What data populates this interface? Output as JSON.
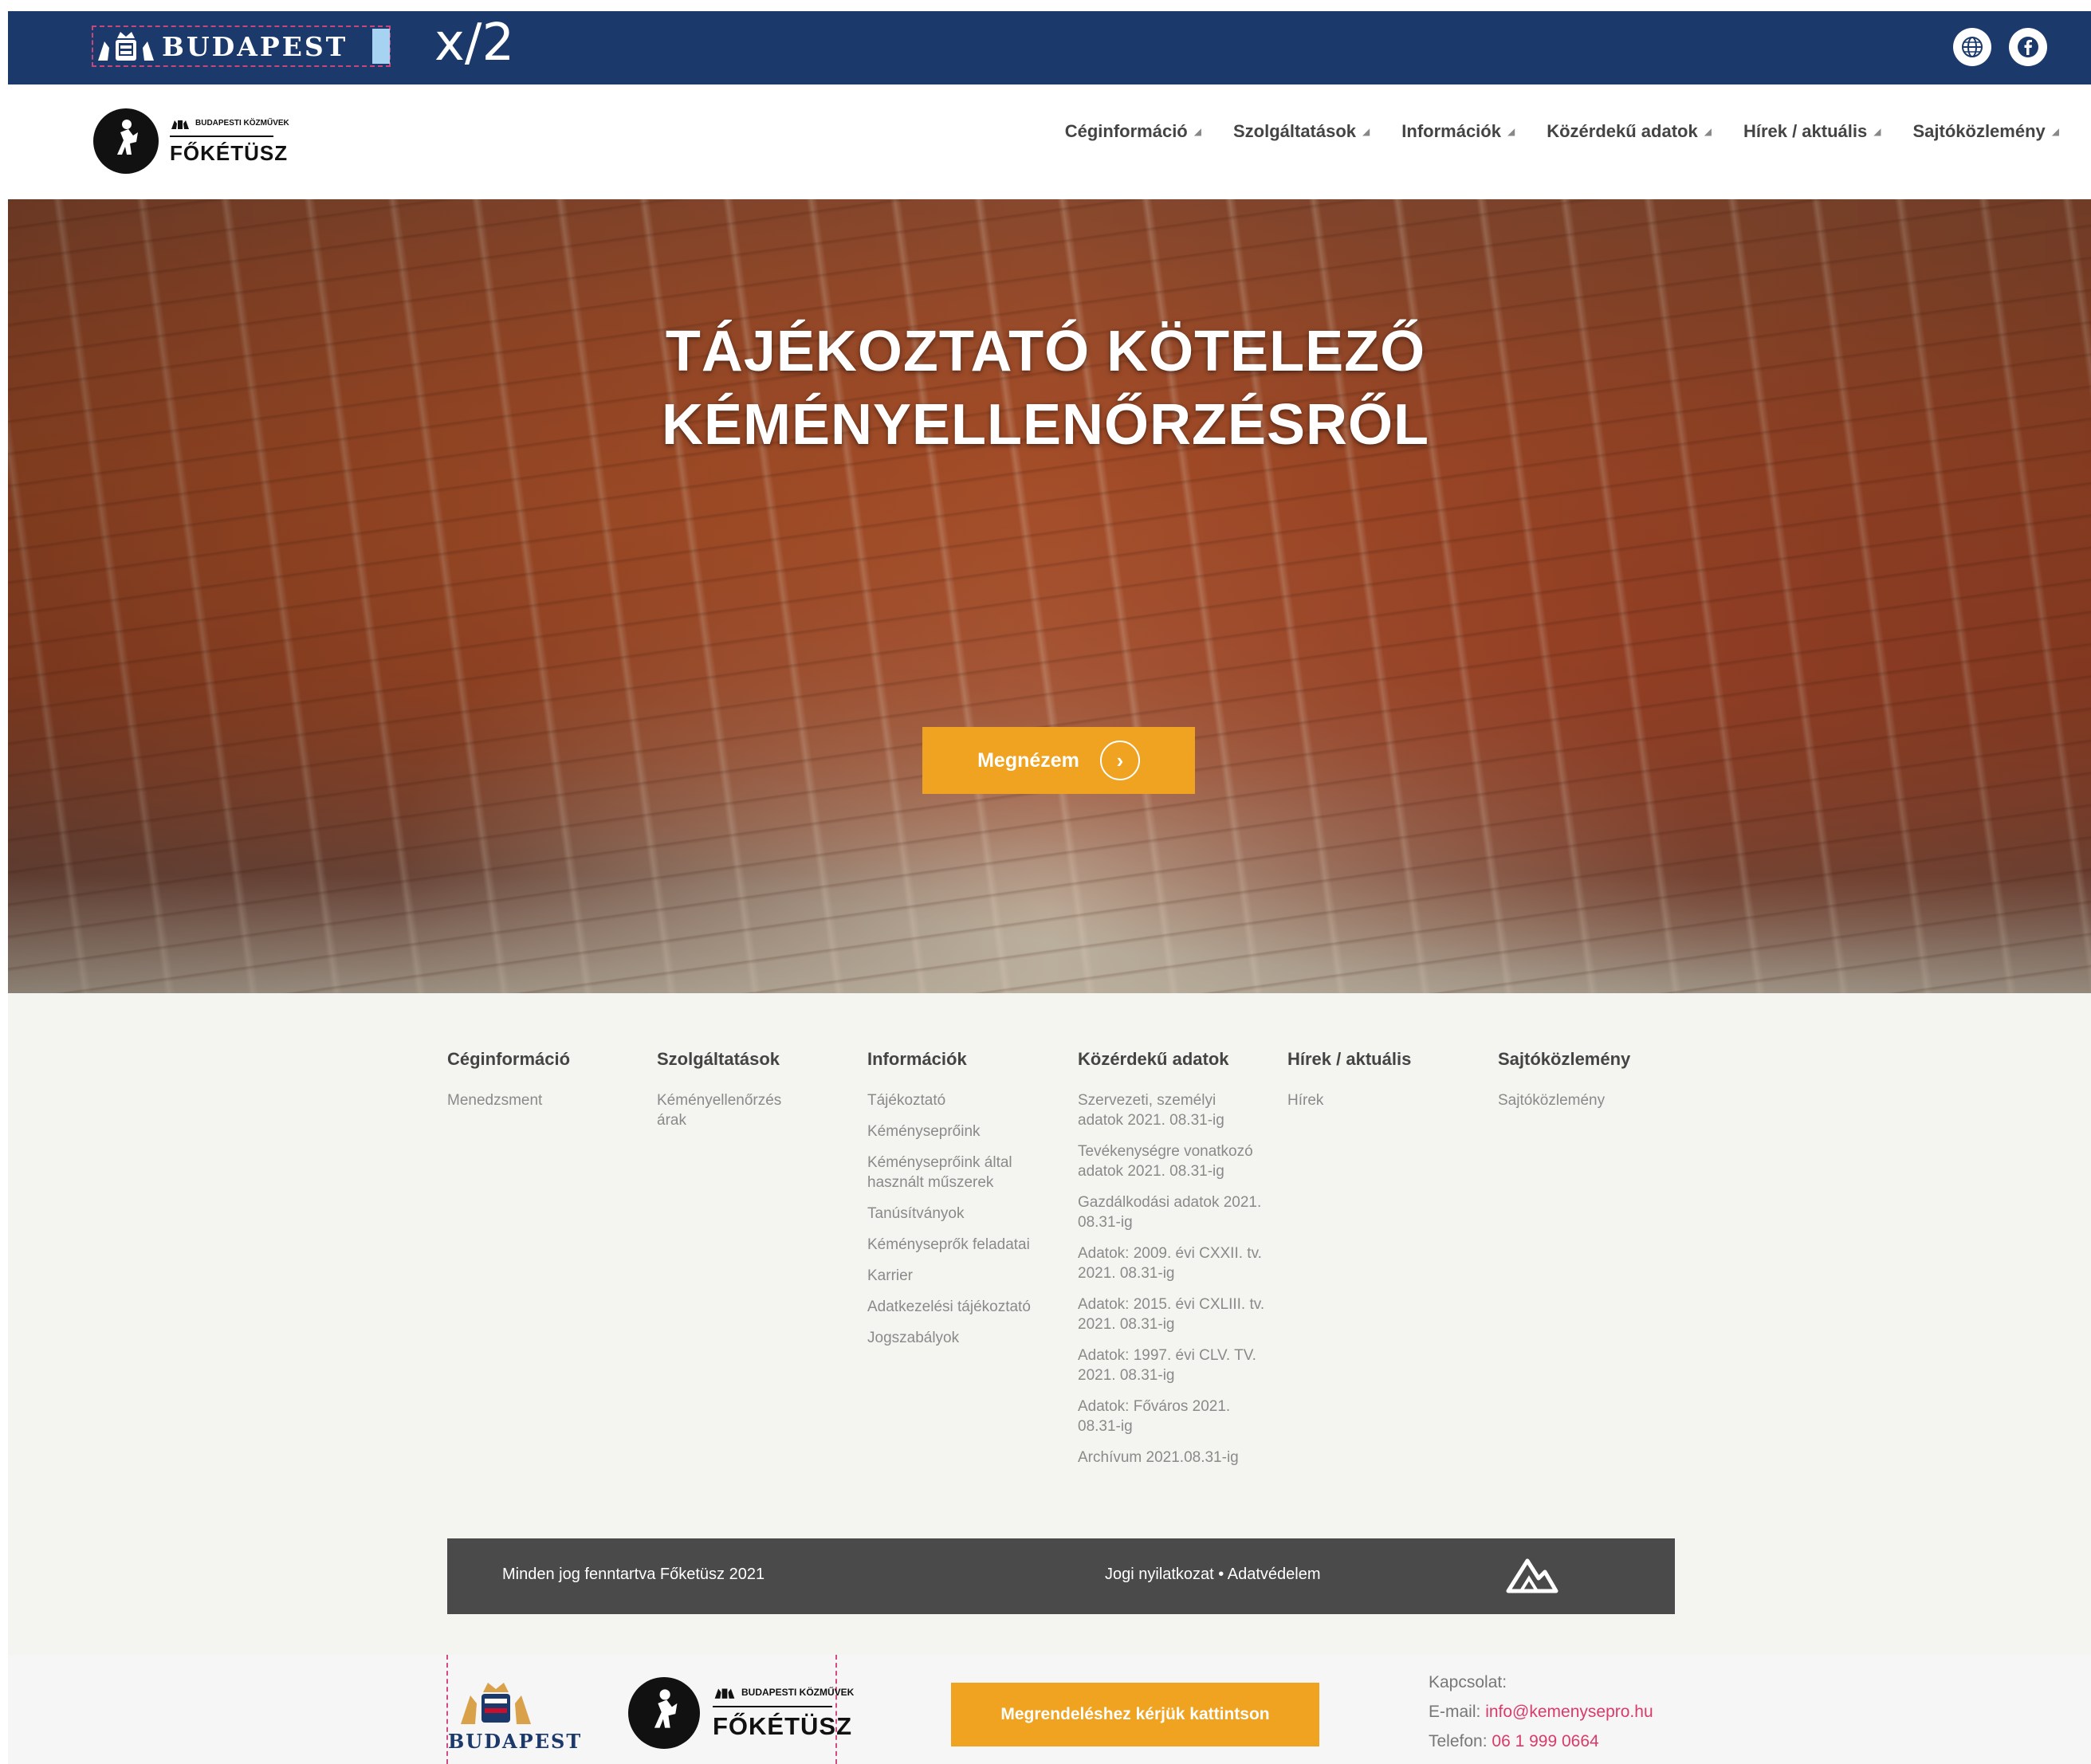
{
  "topbar": {
    "city_name": "BUDAPEST",
    "xmark": "x/2",
    "globe_icon": "globe-icon",
    "facebook_icon": "facebook-icon",
    "background_color": "#1b3a6b"
  },
  "header": {
    "brand_small_text": "BUDAPESTI KÖZMŰVEK",
    "brand_name": "FŐKÉTÜSZ",
    "nav": [
      {
        "label": "Céginformáció"
      },
      {
        "label": "Szolgáltatások"
      },
      {
        "label": "Információk"
      },
      {
        "label": "Közérdekű adatok"
      },
      {
        "label": "Hírek / aktuális"
      },
      {
        "label": "Sajtóközlemény"
      }
    ]
  },
  "hero": {
    "title_line1": "TÁJÉKOZTATÓ KÖTELEZŐ",
    "title_line2": "KÉMÉNYELLENŐRZÉSRŐL",
    "button_label": "Megnézem",
    "button_color": "#efa320"
  },
  "footer": {
    "columns": [
      {
        "title": "Céginformáció",
        "links": [
          "Menedzsment"
        ]
      },
      {
        "title": "Szolgáltatások",
        "links": [
          "Kéményellenőrzés árak"
        ]
      },
      {
        "title": "Információk",
        "links": [
          "Tájékoztató",
          "Kéményseprőink",
          "Kéményseprőink által használt műszerek",
          "Tanúsítványok",
          "Kéményseprők feladatai",
          "Karrier",
          "Adatkezelési tájékoztató",
          "Jogszabályok"
        ]
      },
      {
        "title": "Közérdekű adatok",
        "links": [
          "Szervezeti, személyi adatok 2021. 08.31-ig",
          "Tevékenységre vonatkozó adatok 2021. 08.31-ig",
          "Gazdálkodási adatok 2021. 08.31-ig",
          "Adatok: 2009. évi CXXII. tv. 2021. 08.31-ig",
          "Adatok: 2015. évi CXLIII. tv. 2021. 08.31-ig",
          "Adatok: 1997. évi CLV. TV. 2021. 08.31-ig",
          "Adatok: Főváros 2021. 08.31-ig",
          "Archívum 2021.08.31-ig"
        ]
      },
      {
        "title": "Hírek / aktuális",
        "links": [
          "Hírek"
        ]
      },
      {
        "title": "Sajtóközlemény",
        "links": [
          "Sajtóközlemény"
        ]
      }
    ]
  },
  "copyright": {
    "left_text": "Minden jog fenntartva Főketüsz 2021",
    "right_text": "Jogi nyilatkozat • Adatvédelem"
  },
  "bottom": {
    "city_name": "BUDAPEST",
    "brand_small_text": "BUDAPESTI KÖZMŰVEK",
    "brand_name": "FŐKÉTÜSZ",
    "order_button_label": "Megrendeléshez kérjük kattintson",
    "contact_label": "Kapcsolat:",
    "email_label": "E-mail:",
    "email_value": "info@kemenysepro.hu",
    "phone_label": "Telefon:",
    "phone_value": "06 1 999 0664"
  }
}
